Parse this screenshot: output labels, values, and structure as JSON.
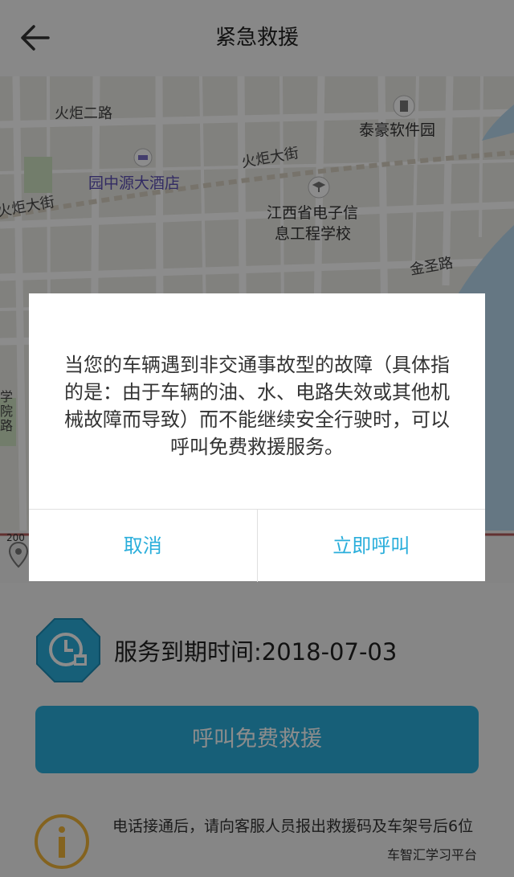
{
  "header": {
    "title": "紧急救援"
  },
  "map": {
    "labels": {
      "huoju_er_lu": "火炬二路",
      "taihao": "泰豪软件园",
      "huoju_dajie_1": "火炬大街",
      "yuanzhongyuan": "园中源大酒店",
      "huoju_dajie_2": "火炬大街",
      "school_line1": "江西省电子信",
      "school_line2": "息工程学校",
      "jinsheng": "金圣路",
      "edge_text": "学院路",
      "scale": "200"
    }
  },
  "service": {
    "expiry_label": "服务到期时间:2018-07-03"
  },
  "call_button": {
    "label": "呼叫免费救援"
  },
  "notice": {
    "text": "电话接通后，请向客服人员报出救援码及车架号后6位"
  },
  "watermark": {
    "text": "车智汇学习平台"
  },
  "dialog": {
    "message": "当您的车辆遇到非交通事故型的故障（具体指的是：由于车辆的油、水、电路失效或其他机械故障而导致）而不能继续安全行驶时，可以呼叫免费救援服务。",
    "cancel_label": "取消",
    "confirm_label": "立即呼叫"
  },
  "colors": {
    "accent": "#2aaedb",
    "poi": "#5b4fb4",
    "water": "#b9d9ef"
  }
}
